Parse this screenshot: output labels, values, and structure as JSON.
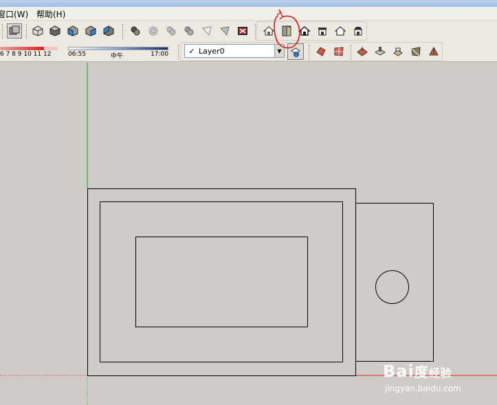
{
  "menubar": {
    "items": [
      "窗口(W)",
      "帮助(H)"
    ]
  },
  "shadow_settings": {
    "month_labels": "6  7  8  9  10 11 12",
    "time_start": "06:55",
    "time_mid": "中午",
    "time_end": "17:00"
  },
  "layers": {
    "current": "Layer0",
    "checkmark": "✓"
  },
  "toolbar_icons": {
    "row1": [
      "face-style-icon",
      "iso-view-icon",
      "top-view-icon",
      "front-view-icon",
      "right-view-icon",
      "back-view-icon",
      "xray-icon",
      "wireframe-icon",
      "hidden-line-icon",
      "shaded-icon",
      "shaded-texture-icon",
      "monochrome-icon",
      "section-icon",
      "make-component-icon",
      "door-icon",
      "house-icon",
      "house-outline-icon",
      "house-front-icon",
      "house-roof-icon"
    ],
    "row2": [
      "layer-manager-icon",
      "sandbox-icon",
      "sandbox-grid-icon",
      "add-detail-icon",
      "stamp-icon",
      "drape-icon",
      "flip-edge-icon",
      "smoove-icon"
    ]
  },
  "colors": {
    "canvas_bg": "#cfccc7",
    "axis_green": "#1f9a1f",
    "axis_red": "#e02020",
    "annotation_red": "#e01010"
  },
  "watermark": {
    "brand": "Bai",
    "brand_du": "度",
    "brand_suffix": "经验",
    "url": "jingyan.baidu.com"
  }
}
